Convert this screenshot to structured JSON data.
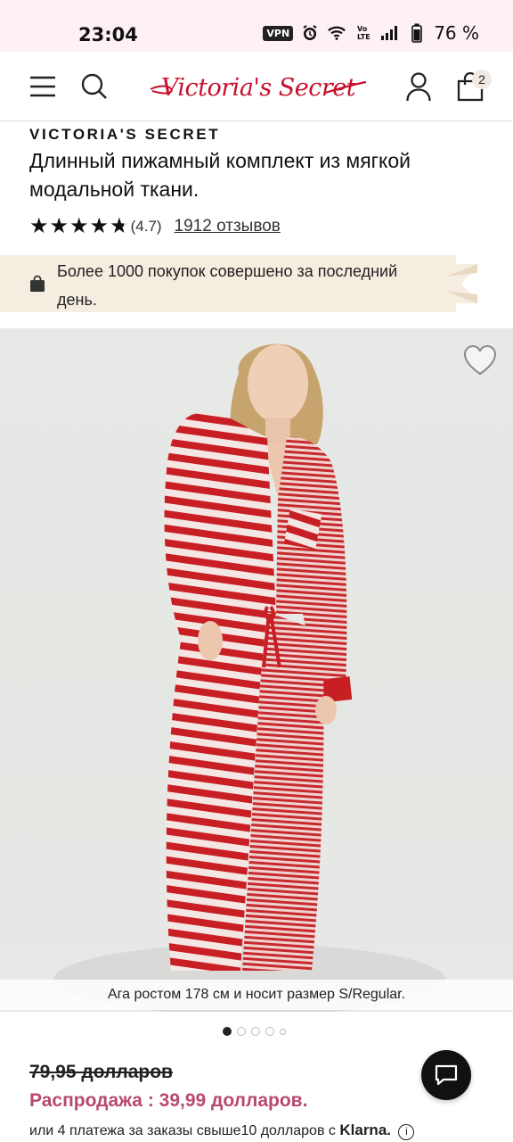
{
  "status_bar": {
    "time": "23:04",
    "vpn_label": "VPN",
    "battery": "76 %"
  },
  "header": {
    "logo_text": "Victoria's Secret",
    "bag_count": "2",
    "icons": [
      "menu-icon",
      "search-icon",
      "account-icon",
      "shopping-bag-icon"
    ]
  },
  "product": {
    "brand": "VICTORIA'S SECRET",
    "title": "Длинный пижамный комплект из мягкой модальной ткани.",
    "rating_value": "(4.7)",
    "rating_stars": 4.7,
    "reviews_link": "1912 отзывов"
  },
  "promo": {
    "text": "Более 1000 покупок совершено за последний день.",
    "icon": "shopping-bag-icon"
  },
  "gallery": {
    "caption": "Ага ростом 178 см и носит размер S/Regular.",
    "dot_count": 5,
    "active_index": 0
  },
  "price": {
    "old": "79,95 долларов",
    "sale": "Распродажа : 39,99 долларов.",
    "klarna_prefix": "или 4 платежа за заказы свыше10 долларов с",
    "klarna_brand": "Klarna."
  },
  "colors": {
    "brand_red": "#c8102e",
    "sale_pink": "#b84a6c",
    "promo_bg": "#f6ede1",
    "status_bg": "#fdf0f6"
  }
}
